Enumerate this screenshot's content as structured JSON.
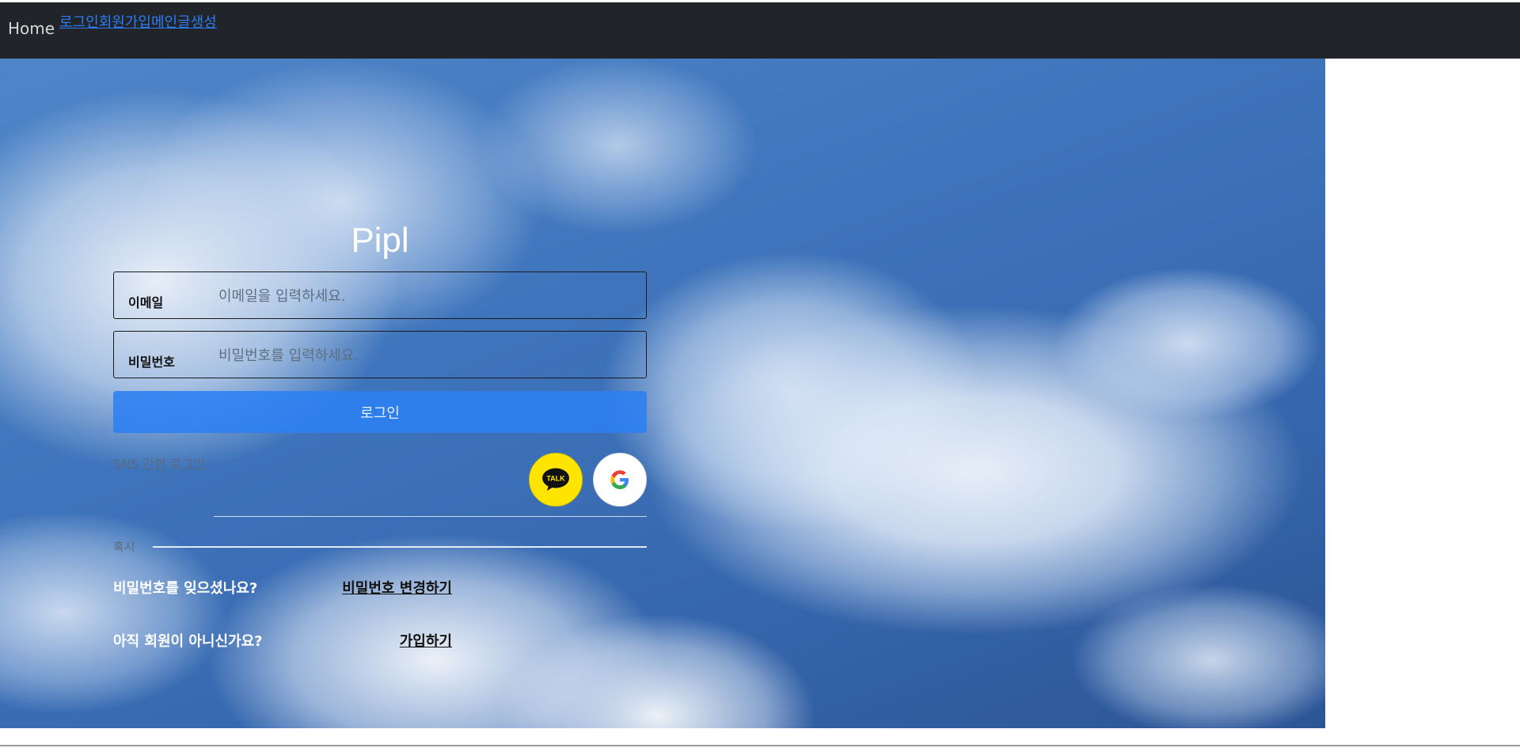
{
  "nav": {
    "home": "Home",
    "links": [
      "로그인",
      "회원가입",
      "메인",
      "글생성"
    ]
  },
  "login": {
    "brand": "Pipl",
    "email_label": "이메일",
    "email_placeholder": "이메일을 입력하세요.",
    "password_label": "비밀번호",
    "password_placeholder": "비밀번호를 입력하세요.",
    "login_button": "로그인",
    "sns_label": "SNS 간편 로그인",
    "kakao_text": "TALK",
    "google_text": "G",
    "or_label": "혹시",
    "forgot_question": "비밀번호를 잊으셨나요?",
    "change_password_link": "비밀번호 변경하기",
    "signup_question": "아직 회원이 아니신가요?",
    "signup_link": "가입하기"
  },
  "colors": {
    "navbar": "#212529",
    "nav_link": "#2d7cf6",
    "login_button": "#2c80f2",
    "kakao": "#fee500"
  }
}
